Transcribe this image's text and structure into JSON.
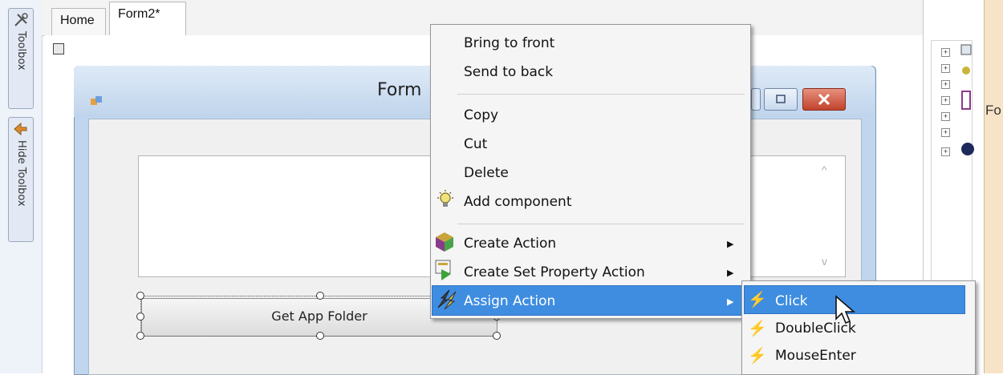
{
  "tabs": {
    "home": "Home",
    "form2": "Form2*"
  },
  "toolbox": {
    "tab_label": "Toolbox",
    "hide_label": "Hide Toolbox"
  },
  "form": {
    "title": "Form",
    "button_label": "Get App Folder",
    "scroll_up": "^",
    "scroll_down": "v"
  },
  "context_menu": {
    "items": [
      "Bring to front",
      "Send to back",
      "Copy",
      "Cut",
      "Delete",
      "Add component",
      "Create Action",
      "Create Set Property Action",
      "Assign Action"
    ],
    "submenu_arrow": "▶"
  },
  "submenu": {
    "items": [
      "Click",
      "DoubleClick",
      "MouseEnter"
    ]
  },
  "right_panel": {
    "partial_label": "Fo"
  },
  "colors": {
    "highlight": "#3f8de0",
    "panel_peach": "#f7e3c8",
    "form_frame": "#bfd6ee"
  }
}
